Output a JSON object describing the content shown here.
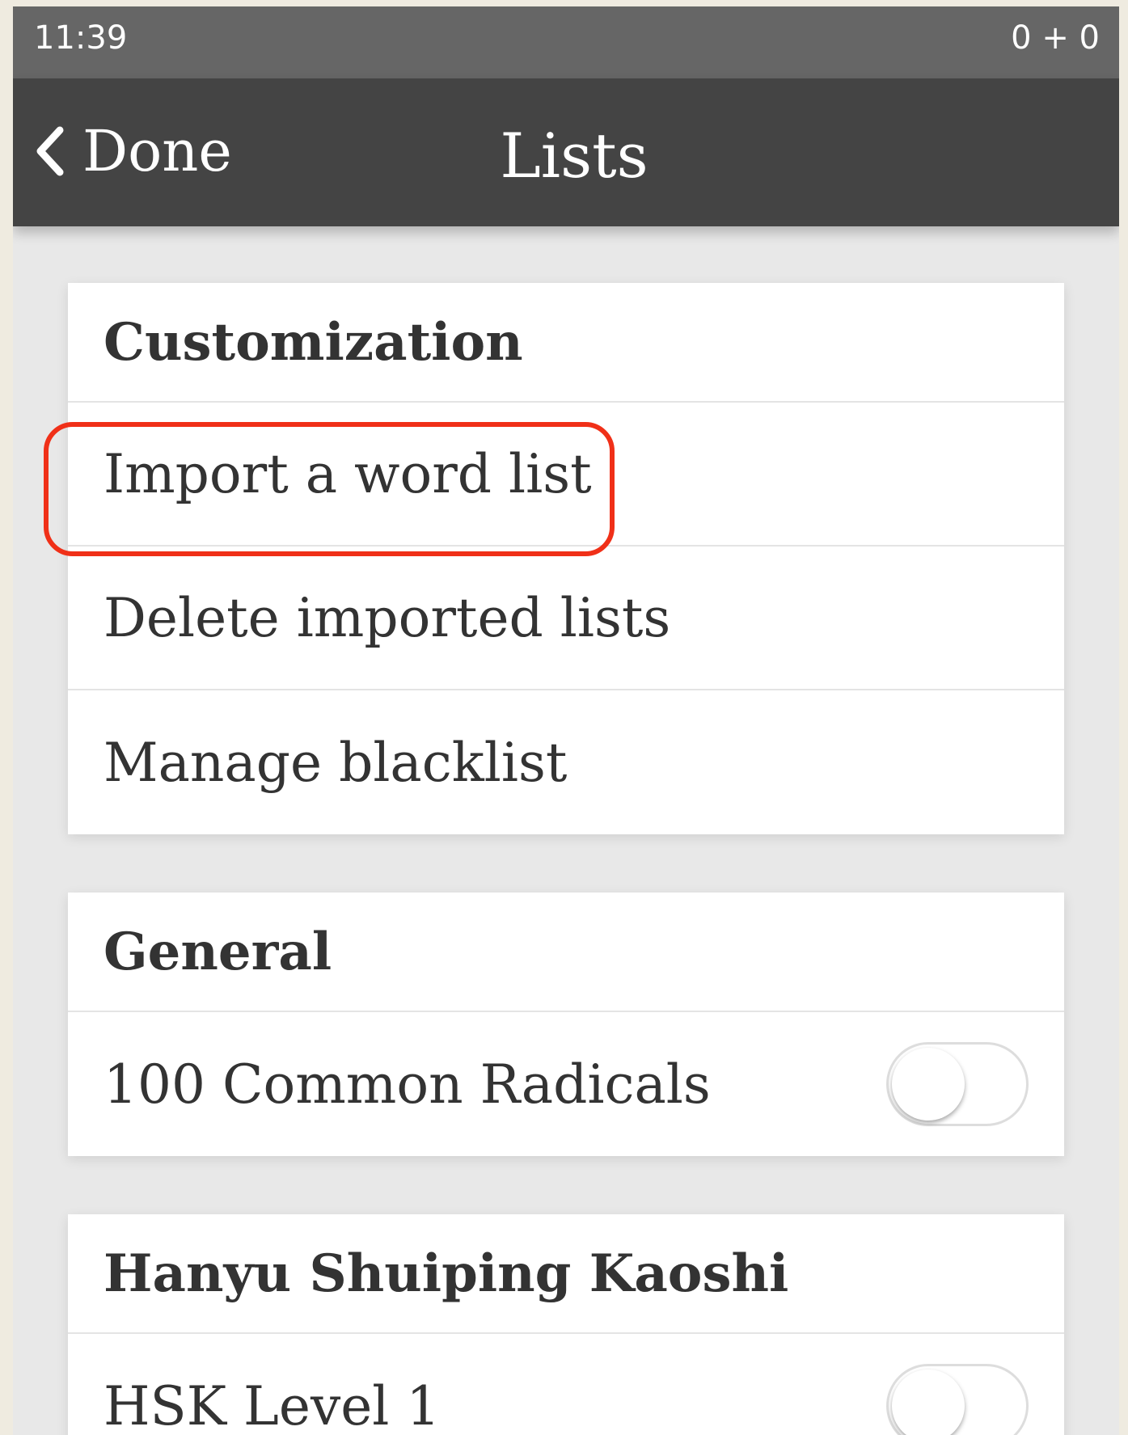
{
  "status_bar": {
    "time": "11:39",
    "right_text": "0 + 0"
  },
  "nav": {
    "back_label": "Done",
    "title": "Lists"
  },
  "sections": {
    "customization": {
      "header": "Customization",
      "items": [
        {
          "label": "Import a word list"
        },
        {
          "label": "Delete imported lists"
        },
        {
          "label": "Manage blacklist"
        }
      ]
    },
    "general": {
      "header": "General",
      "items": [
        {
          "label": "100 Common Radicals",
          "toggle_on": false
        }
      ]
    },
    "hsk": {
      "header": "Hanyu Shuiping Kaoshi",
      "items": [
        {
          "label": "HSK Level 1",
          "toggle_on": false
        }
      ]
    }
  },
  "colors": {
    "status_bar": "#666666",
    "nav_bar": "#444444",
    "highlight": "#f03018",
    "background": "#e8e8e8"
  }
}
